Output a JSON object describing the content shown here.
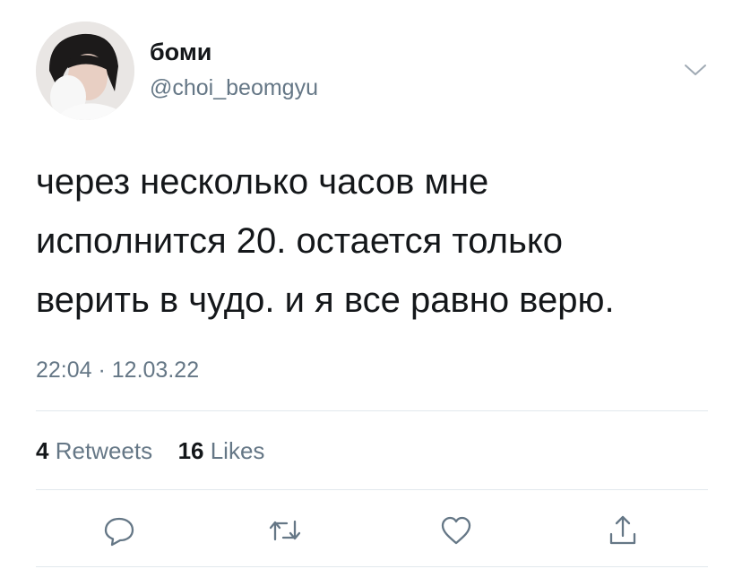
{
  "user": {
    "display_name": "боми",
    "handle": "@choi_beomgyu",
    "avatar_icon": "profile-photo"
  },
  "tweet": {
    "text_lines": [
      "через несколько часов мне",
      "исполнится 20. остается только",
      "верить в чудо. и я все равно верю."
    ],
    "timestamp": "22:04 · 12.03.22"
  },
  "stats": {
    "retweets_count": "4",
    "retweets_label": "Retweets",
    "likes_count": "16",
    "likes_label": "Likes"
  },
  "actions": {
    "reply_icon": "comment-bubble",
    "retweet_icon": "retweet-arrows",
    "like_icon": "heart",
    "share_icon": "share-upload"
  },
  "colors": {
    "text": "#14171a",
    "secondary": "#657786",
    "divider": "#e1e8ed",
    "icon": "#657786"
  }
}
